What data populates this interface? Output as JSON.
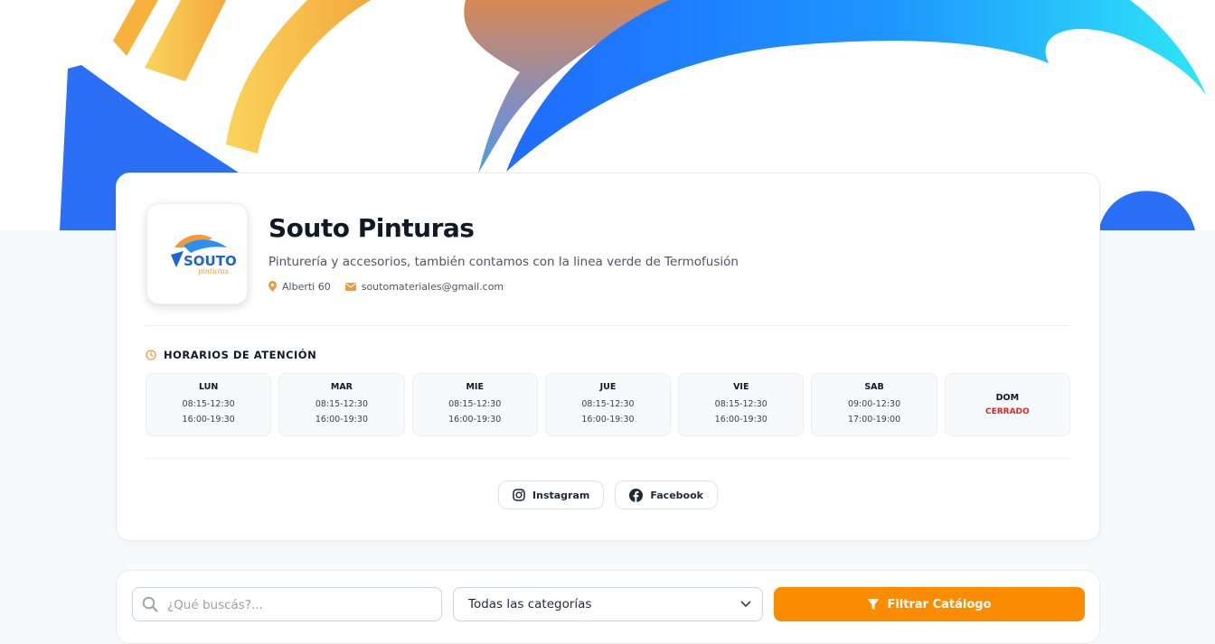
{
  "shop": {
    "name": "Souto Pinturas",
    "description": "Pinturería y accesorios, también contamos con la linea verde de Termofusión",
    "address": "Alberti 60",
    "email": "soutomateriales@gmail.com",
    "logo_text": "SOUTO",
    "logo_subtext": "pinturas"
  },
  "hours": {
    "title": "HORARIOS DE ATENCIÓN",
    "days": [
      {
        "day": "LUN",
        "slot1": "08:15-12:30",
        "slot2": "16:00-19:30"
      },
      {
        "day": "MAR",
        "slot1": "08:15-12:30",
        "slot2": "16:00-19:30"
      },
      {
        "day": "MIE",
        "slot1": "08:15-12:30",
        "slot2": "16:00-19:30"
      },
      {
        "day": "JUE",
        "slot1": "08:15-12:30",
        "slot2": "16:00-19:30"
      },
      {
        "day": "VIE",
        "slot1": "08:15-12:30",
        "slot2": "16:00-19:30"
      },
      {
        "day": "SAB",
        "slot1": "09:00-12:30",
        "slot2": "17:00-19:00"
      },
      {
        "day": "DOM",
        "closed": "CERRADO"
      }
    ]
  },
  "social": {
    "instagram": "Instagram",
    "facebook": "Facebook"
  },
  "search": {
    "placeholder": "¿Qué buscás?...",
    "category_selected": "Todas las categorías",
    "filter_label": "Filtrar Catálogo"
  },
  "colors": {
    "accent": "#fb8c00",
    "closed": "#dc2626",
    "hero_blue": "#2a6ff5",
    "hero_cyan": "#2ad8f5",
    "hero_yellow": "#f7c645"
  },
  "icons": {
    "address": "map-pin-icon",
    "email": "envelope-icon",
    "hours": "clock-icon",
    "instagram": "instagram-icon",
    "facebook": "facebook-icon",
    "search": "search-icon",
    "dropdown": "chevron-down-icon",
    "filter": "filter-icon"
  }
}
